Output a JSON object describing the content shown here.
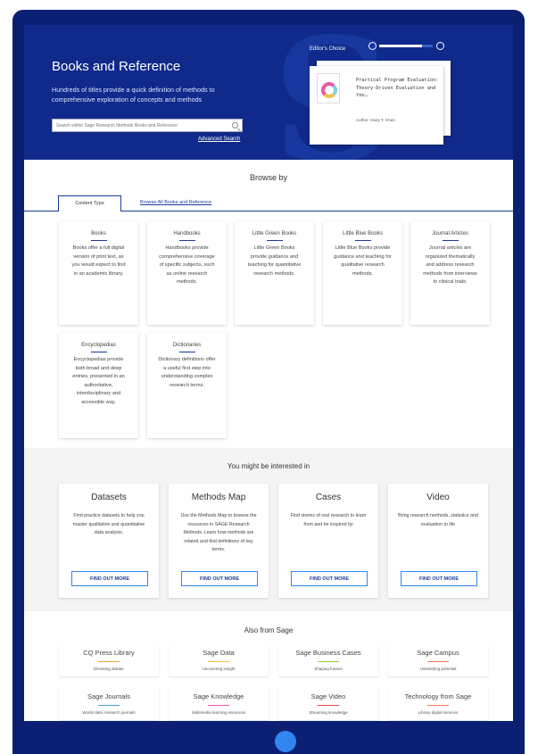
{
  "hero": {
    "title": "Books and Reference",
    "subtitle": "Hundreds of titles provide a quick definition of methods to comprehensive exploration of concepts and methods",
    "search_placeholder": "Search within Sage Research Methods Books and Reference",
    "advanced_search": "Advanced Search",
    "carousel_progress": 0.8
  },
  "editors_choice": {
    "label": "Editor's Choice",
    "book_title": "Practical Program Evaluation: Theory-Driven Evaluation and the…",
    "author": "Author: Huey T. Chen"
  },
  "browse": {
    "title": "Browse by",
    "tabs": [
      "Content Type",
      "Browse All Books and Reference"
    ],
    "content_types": [
      {
        "name": "Books",
        "desc": "Books offer a full digital version of print text, as you would expect to find in an academic library."
      },
      {
        "name": "Handbooks",
        "desc": "Handbooks provide comprehensive coverage of specific subjects, such as online research methods."
      },
      {
        "name": "Little Green Books",
        "desc": "Little Green Books provide guidance and teaching for quantitative research methods."
      },
      {
        "name": "Little Blue Books",
        "desc": "Little Blue Books provide guidance and teaching for qualitative research methods."
      },
      {
        "name": "Journal Articles",
        "desc": "Journal articles are organized thematically and address research methods from interviews to clinical trials."
      },
      {
        "name": "Encyclopedias",
        "desc": "Encyclopedias provide both broad and deep entries, presented in an authoritative, interdisciplinary and accessible way."
      },
      {
        "name": "Dictionaries",
        "desc": "Dictionary definitions offer a useful first step into understanding complex research terms."
      }
    ]
  },
  "interest": {
    "title": "You might be interested in",
    "cards": [
      {
        "title": "Datasets",
        "desc": "Find practice datasets to help you master qualitative and quantitative data analysis.",
        "button": "FIND OUT MORE"
      },
      {
        "title": "Methods Map",
        "desc": "Use the Methods Map to browse the resources in SAGE Research Methods. Learn how methods are related and find definitions of key terms.",
        "button": "FIND OUT MORE"
      },
      {
        "title": "Cases",
        "desc": "Find stories of real research to learn from and be inspired by",
        "button": "FIND OUT MORE"
      },
      {
        "title": "Video",
        "desc": "Bring research methods, statistics and evaluation to life",
        "button": "FIND OUT MORE"
      }
    ]
  },
  "also": {
    "title": "Also from Sage",
    "items": [
      {
        "name": "CQ Press Library",
        "tag": "Elevating debate",
        "color": "#e8a33d"
      },
      {
        "name": "Sage Data",
        "tag": "Uncovering insight",
        "color": "#f2c14e"
      },
      {
        "name": "Sage Business Cases",
        "tag": "Shaping futures",
        "color": "#9ac83c"
      },
      {
        "name": "Sage Campus",
        "tag": "Unleashing potential",
        "color": "#f07a5a"
      },
      {
        "name": "Sage Journals",
        "tag": "World-class research journals",
        "color": "#4aa3df"
      },
      {
        "name": "Sage Knowledge",
        "tag": "Multimedia learning resources",
        "color": "#e85aa5"
      },
      {
        "name": "Sage Video",
        "tag": "Streaming knowledge",
        "color": "#e04a4a"
      },
      {
        "name": "Technology from Sage",
        "tag": "Library digital services",
        "color": "#f07a5a"
      }
    ]
  }
}
